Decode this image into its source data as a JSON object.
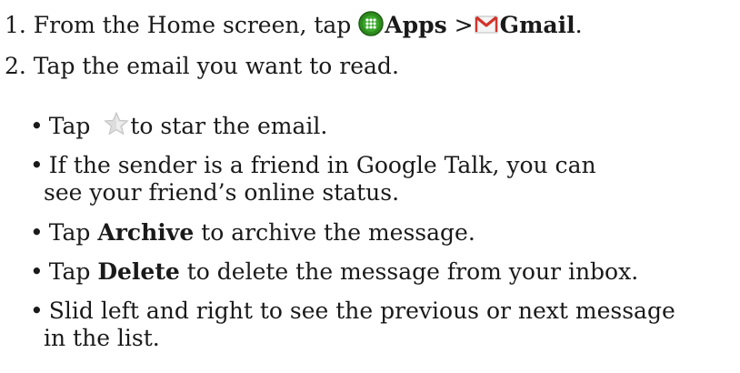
{
  "step1": {
    "text": "1. From the Home screen, tap ",
    "apps_label": "Apps",
    "separator": " >",
    "gmail_label": "Gmail",
    "end": ".",
    "apps_icon": "apps-icon",
    "gmail_icon": "gmail-icon"
  },
  "step2": {
    "text": "2. Tap the email you want to read."
  },
  "bullets": {
    "b1": {
      "pre": "Tap ",
      "post": "to star the email.",
      "icon": "star-icon"
    },
    "b2": {
      "line1": "If the sender is a friend in Google Talk, you can",
      "line2": "see your friend’s online status."
    },
    "b3": {
      "pre": "Tap ",
      "bold": "Archive",
      "post": " to archive the message."
    },
    "b4": {
      "pre": "Tap ",
      "bold": "Delete",
      "post": " to delete the message from your inbox."
    },
    "b5": {
      "line1": "Slid left and right to see the previous or next message",
      "line2": "in the list."
    }
  },
  "bullet_glyph": "•",
  "colors": {
    "apps_icon_bg": "#2e8b1e",
    "gmail_red": "#d2332b",
    "star": "#c9c9c9"
  }
}
